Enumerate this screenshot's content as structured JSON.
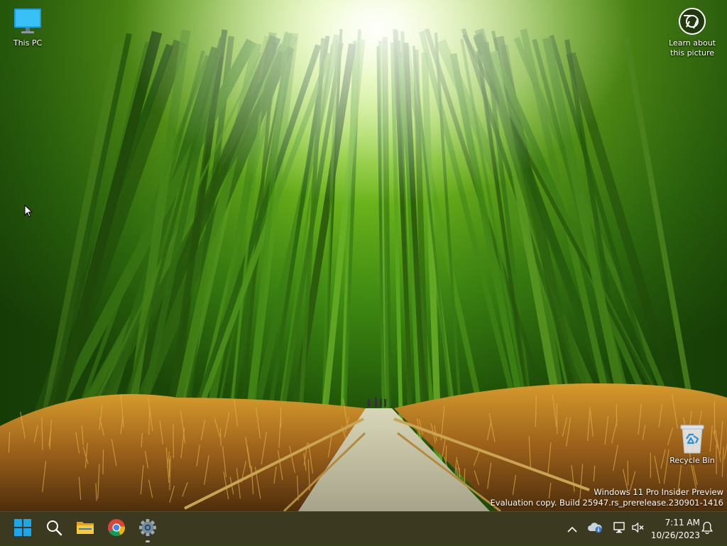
{
  "desktop": {
    "icons": [
      {
        "name": "this-pc",
        "label": "This PC"
      },
      {
        "name": "recycle-bin",
        "label": "Recycle Bin"
      }
    ],
    "spotlight": {
      "label_line1": "Learn about",
      "label_line2": "this picture"
    },
    "watermark": {
      "line1": "Windows 11 Pro Insider Preview",
      "line2": "Evaluation copy. Build 25947.rs_prerelease.230901-1416"
    }
  },
  "taskbar": {
    "background": "#3b3a21",
    "accent": "#1aa7ec",
    "pinned": [
      {
        "name": "start-button",
        "icon": "windows-logo-icon"
      },
      {
        "name": "search-button",
        "icon": "search-icon"
      },
      {
        "name": "file-explorer-button",
        "icon": "folder-icon"
      },
      {
        "name": "chrome-button",
        "icon": "chrome-icon"
      },
      {
        "name": "settings-button",
        "icon": "gear-icon",
        "running": true
      }
    ],
    "tray": {
      "icons": [
        "chevron-up-icon",
        "onedrive-icon",
        "network-icon",
        "volume-muted-icon",
        "notification-bell-icon"
      ],
      "time": "7:11 AM",
      "date": "10/26/2023"
    }
  }
}
